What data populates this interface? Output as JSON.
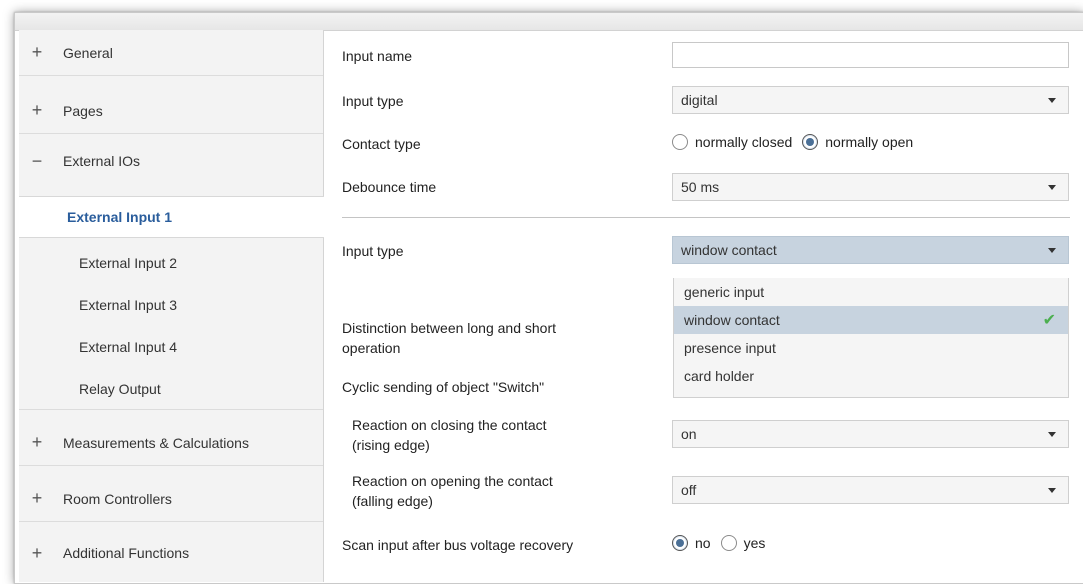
{
  "sidebar": {
    "groups": [
      {
        "sign": "+",
        "label": "General"
      },
      {
        "sign": "+",
        "label": "Pages"
      },
      {
        "sign": "−",
        "label": "External IOs"
      },
      {
        "sign": "+",
        "label": "Measurements & Calculations"
      },
      {
        "sign": "+",
        "label": "Room Controllers"
      },
      {
        "sign": "+",
        "label": "Additional Functions"
      }
    ],
    "subitems": [
      {
        "label": "External Input 1",
        "active": true
      },
      {
        "label": "External Input 2"
      },
      {
        "label": "External Input 3"
      },
      {
        "label": "External Input 4"
      },
      {
        "label": "Relay Output"
      }
    ]
  },
  "main": {
    "input_name": {
      "label": "Input name",
      "value": ""
    },
    "input_type_digital": {
      "label": "Input type",
      "value": "digital"
    },
    "contact_type": {
      "label": "Contact type",
      "options": [
        "normally closed",
        "normally open"
      ],
      "selected": "normally open"
    },
    "debounce": {
      "label": "Debounce time",
      "value": "50 ms"
    },
    "input_type": {
      "label": "Input type",
      "value": "window contact"
    },
    "dropdown_options": [
      "generic input",
      "window contact",
      "presence input",
      "card holder"
    ],
    "dropdown_selected": "window contact",
    "distinction": {
      "label_line1": "Distinction between long and short",
      "label_line2": "operation"
    },
    "cyclic": {
      "label": "Cyclic sending of object \"Switch\""
    },
    "reaction_closing": {
      "label_line1": "Reaction on closing the contact",
      "label_line2": "(rising edge)",
      "value": "on"
    },
    "reaction_opening": {
      "label_line1": "Reaction on opening the contact",
      "label_line2": "(falling edge)",
      "value": "off"
    },
    "scan": {
      "label": "Scan input after bus voltage recovery",
      "options": [
        "no",
        "yes"
      ],
      "selected": "no"
    }
  },
  "colors": {
    "accent": "#2a5d9c",
    "sidebar_bg": "#f3f3f3",
    "select_open_bg": "#c7d3df",
    "check": "#4caf50"
  }
}
